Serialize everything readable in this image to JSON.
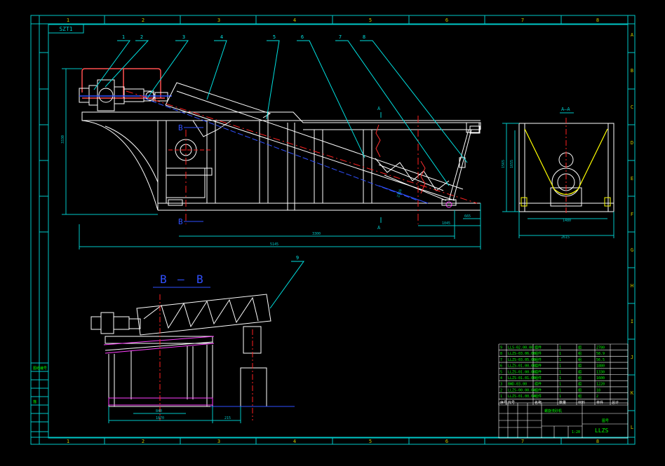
{
  "drawing": {
    "code": "SZT1",
    "title_block_code": "LLZS",
    "colors": {
      "background": "#000000",
      "frame": "#00c8c8",
      "body": "#ffffff",
      "centerline": "#ff2020",
      "dimension": "#00c8c8",
      "leader": "#00e0e0",
      "blue": "#3050ff",
      "magenta": "#ff40ff",
      "yellow": "#ffff00",
      "frame_label": "#c8c800"
    },
    "frame": {
      "columns": [
        "1",
        "2",
        "3",
        "4",
        "5",
        "6",
        "7",
        "8"
      ],
      "rows": [
        "A",
        "B",
        "C",
        "D",
        "E",
        "F",
        "G",
        "H",
        "I",
        "J",
        "K",
        "L"
      ]
    },
    "callouts": [
      "1",
      "2",
      "3",
      "4",
      "5",
      "6",
      "7",
      "8",
      "9"
    ],
    "section_labels": {
      "main_a_top": "A",
      "main_a_bottom": "A",
      "main_b_top": "B",
      "main_b_bottom": "B",
      "side_view": "A—A",
      "b_view_left": "B",
      "b_view_dash": "—",
      "b_view_right": "B"
    },
    "main_dimensions": [
      "3330",
      "3300",
      "5145",
      "1045",
      "665",
      "2316"
    ],
    "side_dimensions": [
      "1565",
      "1655",
      "1480",
      "2615"
    ],
    "b_dimensions": [
      "840",
      "1870",
      "215"
    ],
    "bom_rows": [
      {
        "no": "9",
        "code": "LLS-02.00.00",
        "name": "组件",
        "qty": "1",
        "mat": "组",
        "wt": "2780"
      },
      {
        "no": "8",
        "code": "LLZS-03.06.00",
        "name": "组件",
        "qty": "1",
        "mat": "组",
        "wt": "58.9"
      },
      {
        "no": "7",
        "code": "LLZS-03.05.00",
        "name": "组件",
        "qty": "1",
        "mat": "组",
        "wt": "56.5"
      },
      {
        "no": "6",
        "code": "LLZS-01.00.00",
        "name": "组件",
        "qty": "1",
        "mat": "组",
        "wt": "1880"
      },
      {
        "no": "5",
        "code": "LLZS-01.00.00",
        "name": "组件",
        "qty": "1",
        "mat": "组",
        "wt": "1330"
      },
      {
        "no": "4",
        "code": "LLZS-01.01.00",
        "name": "组件",
        "qty": "1",
        "mat": "组",
        "wt": "1600"
      },
      {
        "no": "3",
        "code": "BWD-03.00",
        "name": "组件",
        "qty": "1",
        "mat": "组",
        "wt": "1220"
      },
      {
        "no": "2",
        "code": "LLZS-00.00.04",
        "name": "组件",
        "qty": "1",
        "mat": "组",
        "wt": "18"
      },
      {
        "no": "1",
        "code": "LLZS-01.00.04",
        "name": "组件",
        "qty": "1",
        "mat": "组",
        "wt": "2"
      }
    ],
    "bom_header": [
      "序号",
      "代号",
      "名称",
      "数量",
      "材料",
      "单件",
      "总计",
      "备注"
    ],
    "title_block": {
      "drawing_name": "螺旋洗砂机",
      "scale": "1:20",
      "weight": "",
      "sheet": "",
      "org": "图号"
    },
    "left_strip": [
      "图纸编号",
      "描",
      "",
      "",
      "",
      "",
      "",
      "",
      ""
    ]
  }
}
